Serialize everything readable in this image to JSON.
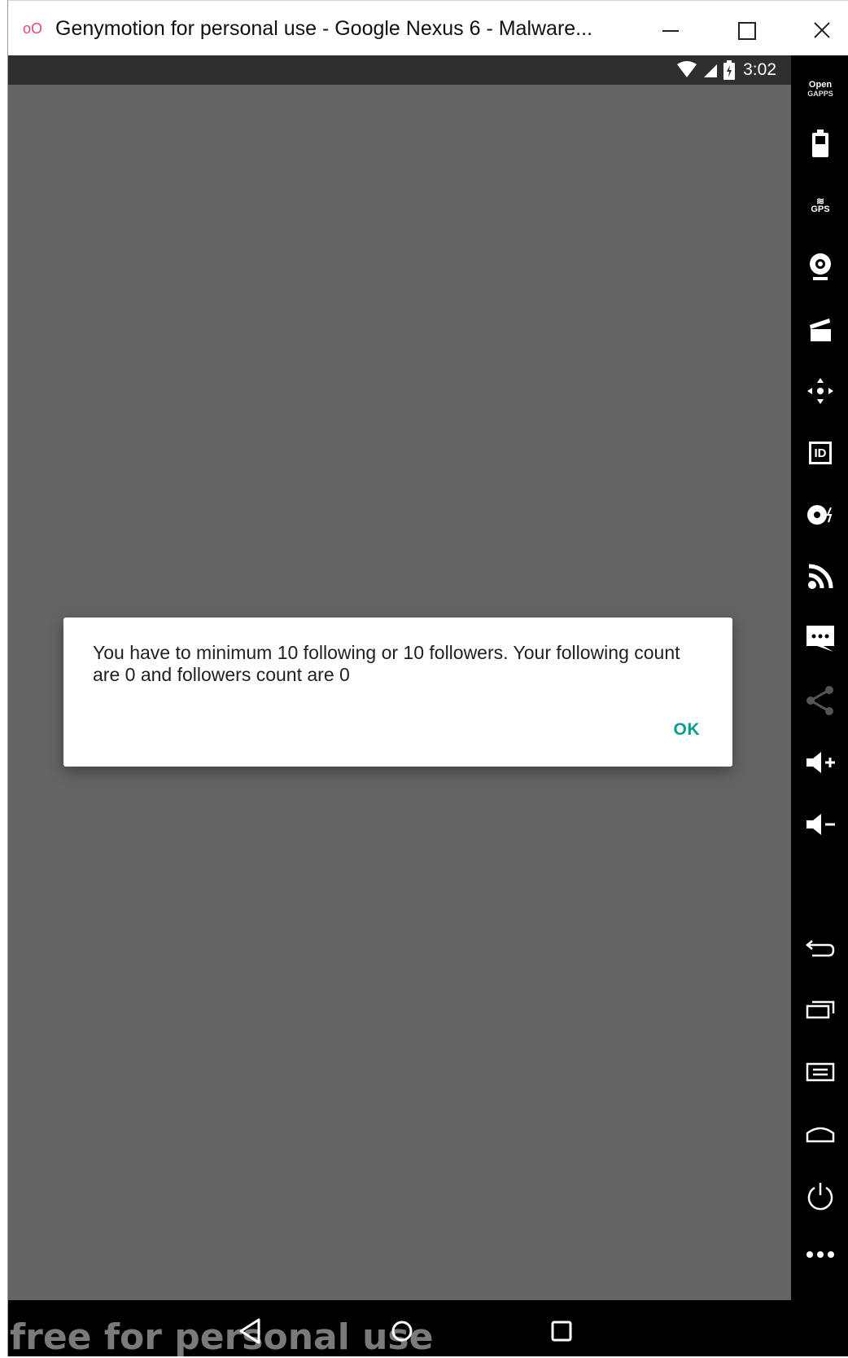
{
  "window": {
    "title": "Genymotion for personal use - Google Nexus 6 - Malware...",
    "logo": "oO"
  },
  "statusbar": {
    "time": "3:02",
    "icons": [
      "wifi-icon",
      "cell-signal-icon",
      "battery-icon"
    ]
  },
  "dialog": {
    "message": "You have to minimum 10 following or 10 followers. Your following count are 0 and followers count are 0",
    "ok_label": "OK"
  },
  "navbar": {
    "watermark": "free for personal use",
    "buttons": [
      "back-icon",
      "home-icon",
      "recent-apps-icon"
    ]
  },
  "sidebar": {
    "opengapps_line1": "Open",
    "opengapps_line2": "GAPPS",
    "gps_label": "GPS",
    "id_label": "ID",
    "items": [
      "open-gapps",
      "battery",
      "gps",
      "camera",
      "media",
      "move",
      "id",
      "disk-io",
      "cast",
      "sms",
      "share",
      "volume-up",
      "volume-down",
      "back",
      "recent",
      "menu",
      "home",
      "power",
      "more"
    ]
  },
  "colors": {
    "screen_bg": "#646464",
    "dialog_button": "#109b8f",
    "logo_accent": "#e5447a"
  }
}
